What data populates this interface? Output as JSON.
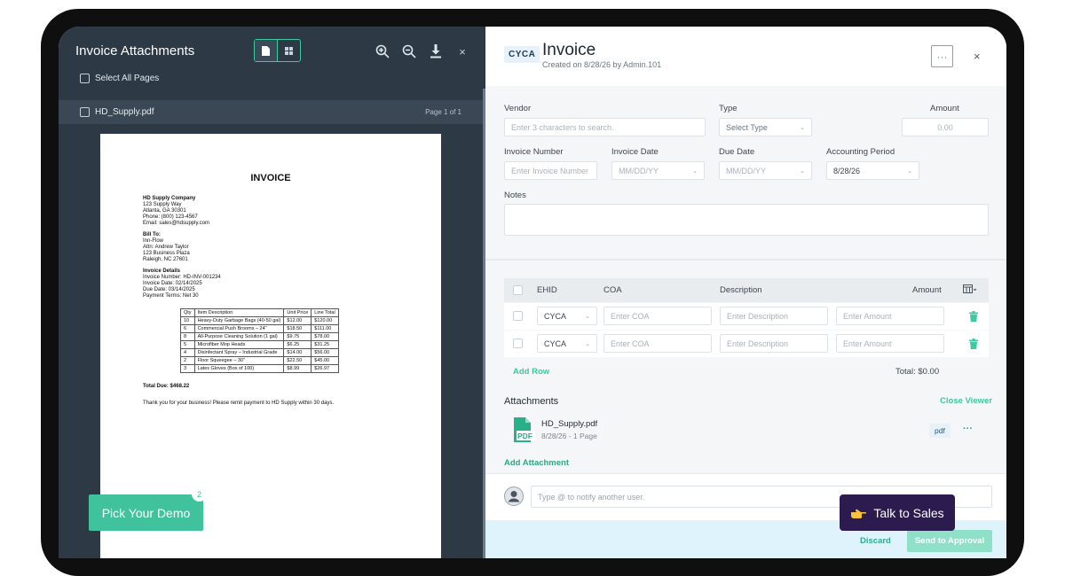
{
  "left": {
    "title": "Invoice Attachments",
    "select_all": "Select All Pages",
    "file_name": "HD_Supply.pdf",
    "page_info": "Page 1 of 1",
    "pdf": {
      "heading": "INVOICE",
      "company": [
        "HD Supply Company",
        "123 Supply Way",
        "Atlanta, GA 30301",
        "Phone: (800) 123-4567",
        "Email: sales@hdsupply.com"
      ],
      "bill_to": [
        "Bill To:",
        "Inn-Flow",
        "Attn: Andrew Taylor",
        "123 Business Plaza",
        "Raleigh, NC 27601"
      ],
      "details": [
        "Invoice Details",
        "Invoice Number: HD-INV-001234",
        "Invoice Date: 02/14/2025",
        "Due Date: 03/14/2025",
        "Payment Terms: Net 30"
      ],
      "table_headers": [
        "Qty",
        "Item Description",
        "Unit Price",
        "Line Total"
      ],
      "table_rows": [
        [
          "10",
          "Heavy-Duty Garbage Bags (40-50 gal)",
          "$12.00",
          "$120.00"
        ],
        [
          "6",
          "Commercial Push Brooms – 24\"",
          "$18.50",
          "$111.00"
        ],
        [
          "8",
          "All-Purpose Cleaning Solution (1 gal)",
          "$9.75",
          "$78.00"
        ],
        [
          "5",
          "Microfiber Mop Heads",
          "$6.25",
          "$31.25"
        ],
        [
          "4",
          "Disinfectant Spray – Industrial Grade",
          "$14.00",
          "$56.00"
        ],
        [
          "2",
          "Floor Squeegee – 30\"",
          "$22.50",
          "$45.00"
        ],
        [
          "3",
          "Latex Gloves (Box of 100)",
          "$8.99",
          "$26.97"
        ]
      ],
      "total_due": "Total Due: $468.22",
      "thanks": "Thank you for your business! Please remit payment to HD Supply within 30 days."
    },
    "demo_button": "Pick Your Demo",
    "demo_badge": "2"
  },
  "right": {
    "tag": "CYCA",
    "title": "Invoice",
    "subtitle": "Created on 8/28/26 by Admin.101",
    "more": "···",
    "close": "×",
    "vendor_label": "Vendor",
    "vendor_placeholder": "Enter 3 characters to search.",
    "type_label": "Type",
    "type_value": "Select Type",
    "amount_label": "Amount",
    "amount_value": "0.00",
    "invoice_number_label": "Invoice Number",
    "invoice_number_placeholder": "Enter Invoice Number",
    "invoice_date_label": "Invoice Date",
    "invoice_date_placeholder": "MM/DD/YY",
    "due_date_label": "Due Date",
    "due_date_placeholder": "MM/DD/YY",
    "accounting_period_label": "Accounting Period",
    "accounting_period_value": "8/28/26",
    "notes_label": "Notes",
    "table_headers": {
      "ehid": "EHID",
      "coa": "COA",
      "description": "Description",
      "amount": "Amount"
    },
    "rows": [
      {
        "ehid": "CYCA",
        "coa": "Enter COA",
        "description": "Enter Description",
        "amount": "Enter Amount"
      },
      {
        "ehid": "CYCA",
        "coa": "Enter COA",
        "description": "Enter Description",
        "amount": "Enter Amount"
      }
    ],
    "add_row": "Add Row",
    "total": "Total: $0.00",
    "attachments_title": "Attachments",
    "close_viewer": "Close Viewer",
    "attachment_name": "HD_Supply.pdf",
    "attachment_meta": "8/28/26 - 1 Page",
    "attachment_type": "pdf",
    "attachment_icon_label": "PDF",
    "add_attachment": "Add Attachment",
    "comment_placeholder": "Type @ to notify another user.",
    "discard": "Discard",
    "send": "Send to Approval"
  },
  "sales_button": "Talk to Sales",
  "colors": {
    "accent": "#3ec9a3",
    "left_bg": "#2d3a46",
    "sales_bg": "#2b1b4f"
  }
}
